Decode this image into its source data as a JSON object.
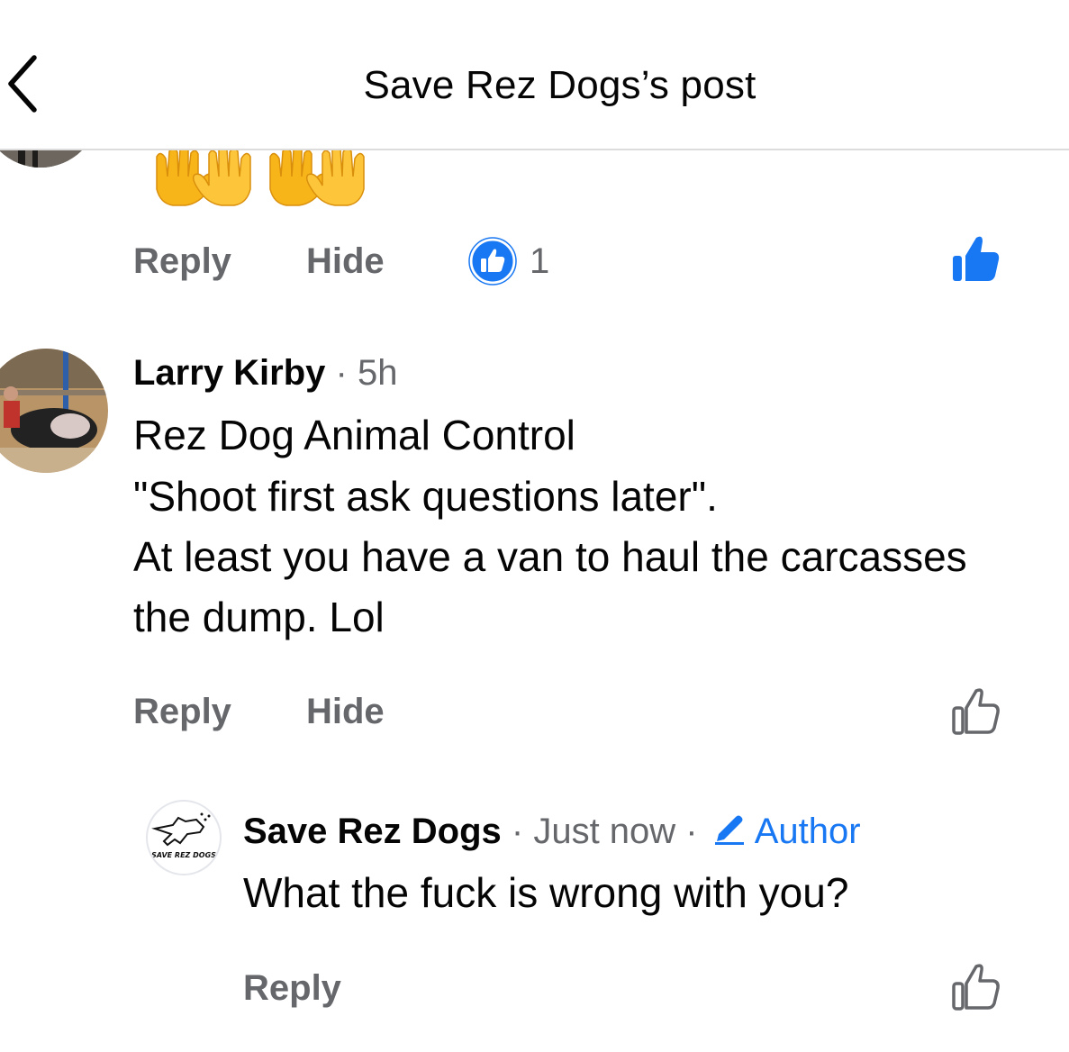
{
  "header": {
    "title": "Save Rez Dogs’s post"
  },
  "previous_comment": {
    "emoji_text": "🙌🙌",
    "actions": {
      "reply": "Reply",
      "hide": "Hide"
    },
    "reaction_count": "1",
    "liked": true
  },
  "comment": {
    "author": "Larry Kirby",
    "separator": " · ",
    "time": "5h",
    "lines": [
      "Rez Dog Animal Control",
      "\"Shoot first ask questions later\".",
      "At least you have a van to haul the carcasses",
      "the dump.  Lol"
    ],
    "actions": {
      "reply": "Reply",
      "hide": "Hide"
    }
  },
  "reply": {
    "author": "Save Rez Dogs",
    "separator": " · ",
    "time": "Just now",
    "separator2": " · ",
    "badge": "Author",
    "text": "What the fuck is wrong with you?",
    "logo_text": "SAVE REZ DOGS",
    "actions": {
      "reply": "Reply"
    }
  },
  "colors": {
    "accent": "#1877f2",
    "muted": "#65676b",
    "text": "#050505"
  },
  "icons": {
    "back": "chevron-left-icon",
    "like_filled": "thumbs-up-filled-icon",
    "like_outline": "thumbs-up-outline-icon",
    "reaction": "like-reaction-icon",
    "pencil": "pencil-icon"
  }
}
